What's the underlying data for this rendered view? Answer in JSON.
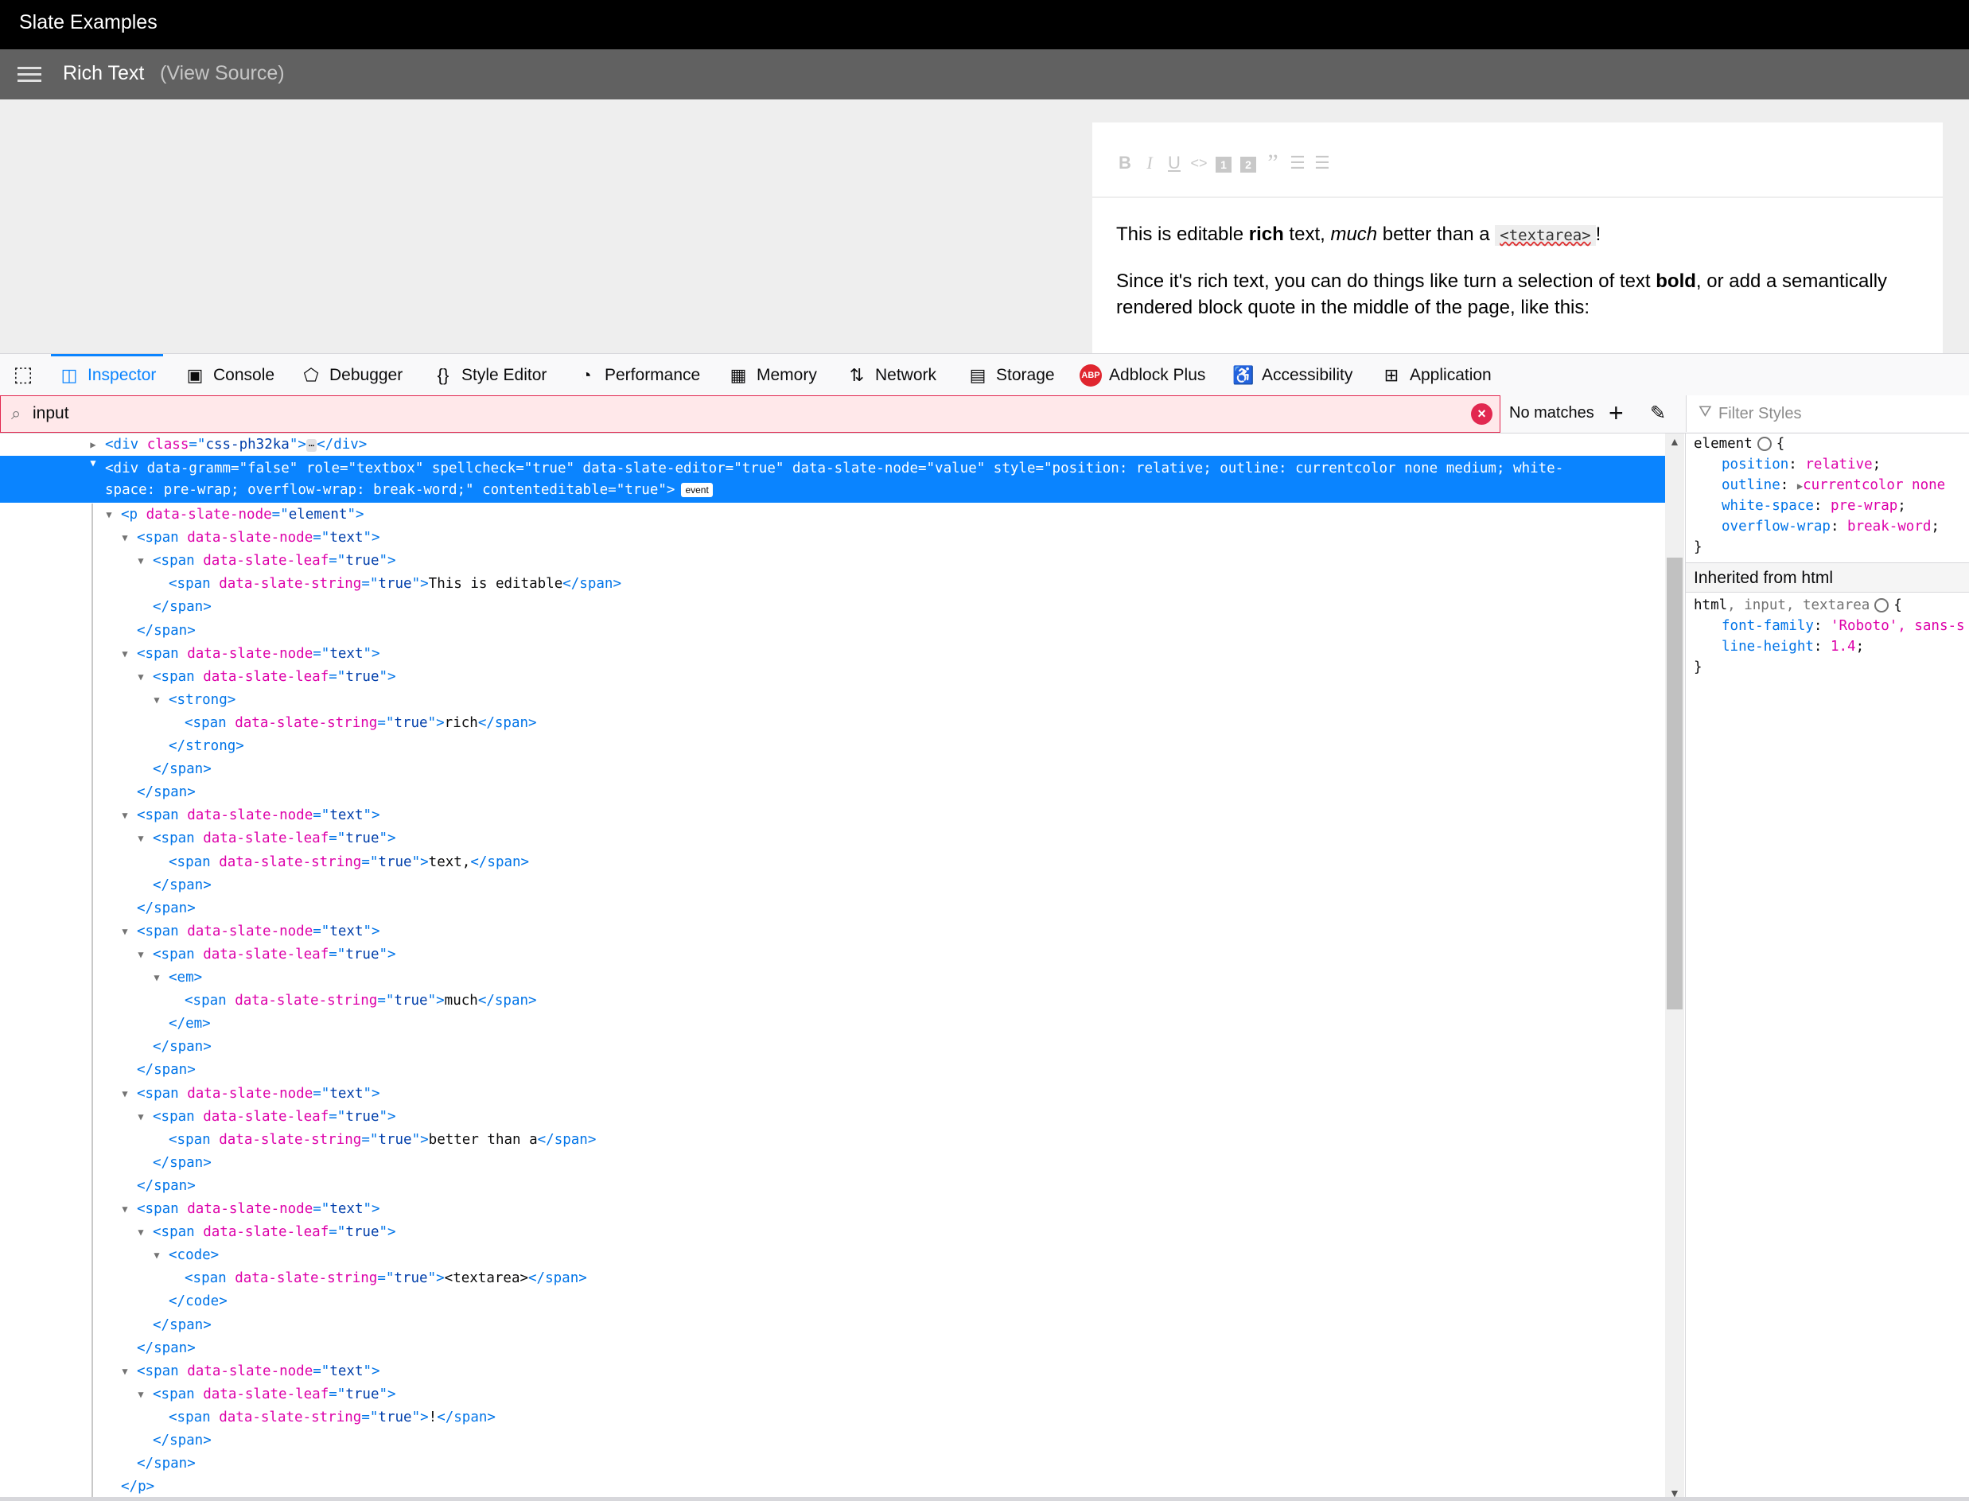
{
  "page": {
    "app_title": "Slate Examples",
    "example_title": "Rich Text",
    "view_source": "(View Source)"
  },
  "editor": {
    "toolbar": [
      {
        "name": "bold",
        "glyph": "B"
      },
      {
        "name": "italic",
        "glyph": "I"
      },
      {
        "name": "underline",
        "glyph": "U"
      },
      {
        "name": "code",
        "glyph": "<>"
      },
      {
        "name": "heading-one",
        "glyph": "1"
      },
      {
        "name": "heading-two",
        "glyph": "2"
      },
      {
        "name": "block-quote",
        "glyph": "”"
      },
      {
        "name": "numbered-list",
        "glyph": "☰"
      },
      {
        "name": "bulleted-list",
        "glyph": "☰"
      }
    ],
    "p1": {
      "a": "This is editable ",
      "b": "rich",
      "c": " text, ",
      "d": "much",
      "e": " better than a ",
      "f": "<textarea>",
      "g": "!"
    },
    "p2": {
      "a": "Since it's rich text, you can do things like turn a selection of text ",
      "b": "bold",
      "c": ", or add a semantically rendered block quote in the middle of the page, like this:"
    }
  },
  "devtools": {
    "tabs": [
      {
        "label": "Inspector",
        "icon": "inspector-icon",
        "selected": true
      },
      {
        "label": "Console",
        "icon": "console-icon"
      },
      {
        "label": "Debugger",
        "icon": "debugger-icon"
      },
      {
        "label": "Style Editor",
        "icon": "braces-icon"
      },
      {
        "label": "Performance",
        "icon": "gauge-icon"
      },
      {
        "label": "Memory",
        "icon": "chip-icon"
      },
      {
        "label": "Network",
        "icon": "arrows-icon"
      },
      {
        "label": "Storage",
        "icon": "storage-icon"
      },
      {
        "label": "Adblock Plus",
        "icon": "abp-icon"
      },
      {
        "label": "Accessibility",
        "icon": "accessibility-icon"
      },
      {
        "label": "Application",
        "icon": "grid-icon"
      }
    ],
    "abp_badge": "ABP",
    "search": {
      "value": "input",
      "status": "No matches"
    },
    "filter_styles_placeholder": "Filter Styles",
    "event_badge": "event",
    "ellipsis_badge": "⋯"
  },
  "markup_lines": [
    {
      "d": 0,
      "tw": "closed",
      "p": [
        [
          "t",
          "<div "
        ],
        [
          "a",
          "class"
        ],
        [
          "t",
          "=\""
        ],
        [
          "v",
          "css-ph32ka"
        ],
        [
          "t",
          "\">"
        ],
        [
          "badge",
          ""
        ],
        [
          "t",
          "</div>"
        ]
      ]
    },
    {
      "d": 1,
      "tw": "open",
      "p": [
        [
          "t",
          "<p "
        ],
        [
          "a",
          "data-slate-node"
        ],
        [
          "t",
          "=\""
        ],
        [
          "v",
          "element"
        ],
        [
          "t",
          "\">"
        ]
      ]
    },
    {
      "d": 2,
      "tw": "open",
      "p": [
        [
          "t",
          "<span "
        ],
        [
          "a",
          "data-slate-node"
        ],
        [
          "t",
          "=\""
        ],
        [
          "v",
          "text"
        ],
        [
          "t",
          "\">"
        ]
      ]
    },
    {
      "d": 3,
      "tw": "open",
      "p": [
        [
          "t",
          "<span "
        ],
        [
          "a",
          "data-slate-leaf"
        ],
        [
          "t",
          "=\""
        ],
        [
          "v",
          "true"
        ],
        [
          "t",
          "\">"
        ]
      ]
    },
    {
      "d": 4,
      "tw": "",
      "p": [
        [
          "t",
          "<span "
        ],
        [
          "a",
          "data-slate-string"
        ],
        [
          "t",
          "=\""
        ],
        [
          "v",
          "true"
        ],
        [
          "t",
          "\">"
        ],
        [
          "x",
          "This is editable"
        ],
        [
          "t",
          "</span>"
        ]
      ]
    },
    {
      "d": 3,
      "tw": "",
      "p": [
        [
          "t",
          "</span>"
        ]
      ]
    },
    {
      "d": 2,
      "tw": "",
      "p": [
        [
          "t",
          "</span>"
        ]
      ]
    },
    {
      "d": 2,
      "tw": "open",
      "p": [
        [
          "t",
          "<span "
        ],
        [
          "a",
          "data-slate-node"
        ],
        [
          "t",
          "=\""
        ],
        [
          "v",
          "text"
        ],
        [
          "t",
          "\">"
        ]
      ]
    },
    {
      "d": 3,
      "tw": "open",
      "p": [
        [
          "t",
          "<span "
        ],
        [
          "a",
          "data-slate-leaf"
        ],
        [
          "t",
          "=\""
        ],
        [
          "v",
          "true"
        ],
        [
          "t",
          "\">"
        ]
      ]
    },
    {
      "d": 4,
      "tw": "open",
      "p": [
        [
          "t",
          "<strong>"
        ]
      ]
    },
    {
      "d": 5,
      "tw": "",
      "p": [
        [
          "t",
          "<span "
        ],
        [
          "a",
          "data-slate-string"
        ],
        [
          "t",
          "=\""
        ],
        [
          "v",
          "true"
        ],
        [
          "t",
          "\">"
        ],
        [
          "x",
          "rich"
        ],
        [
          "t",
          "</span>"
        ]
      ]
    },
    {
      "d": 4,
      "tw": "",
      "p": [
        [
          "t",
          "</strong>"
        ]
      ]
    },
    {
      "d": 3,
      "tw": "",
      "p": [
        [
          "t",
          "</span>"
        ]
      ]
    },
    {
      "d": 2,
      "tw": "",
      "p": [
        [
          "t",
          "</span>"
        ]
      ]
    },
    {
      "d": 2,
      "tw": "open",
      "p": [
        [
          "t",
          "<span "
        ],
        [
          "a",
          "data-slate-node"
        ],
        [
          "t",
          "=\""
        ],
        [
          "v",
          "text"
        ],
        [
          "t",
          "\">"
        ]
      ]
    },
    {
      "d": 3,
      "tw": "open",
      "p": [
        [
          "t",
          "<span "
        ],
        [
          "a",
          "data-slate-leaf"
        ],
        [
          "t",
          "=\""
        ],
        [
          "v",
          "true"
        ],
        [
          "t",
          "\">"
        ]
      ]
    },
    {
      "d": 4,
      "tw": "",
      "p": [
        [
          "t",
          "<span "
        ],
        [
          "a",
          "data-slate-string"
        ],
        [
          "t",
          "=\""
        ],
        [
          "v",
          "true"
        ],
        [
          "t",
          "\">"
        ],
        [
          "x",
          "text,"
        ],
        [
          "t",
          "</span>"
        ]
      ]
    },
    {
      "d": 3,
      "tw": "",
      "p": [
        [
          "t",
          "</span>"
        ]
      ]
    },
    {
      "d": 2,
      "tw": "",
      "p": [
        [
          "t",
          "</span>"
        ]
      ]
    },
    {
      "d": 2,
      "tw": "open",
      "p": [
        [
          "t",
          "<span "
        ],
        [
          "a",
          "data-slate-node"
        ],
        [
          "t",
          "=\""
        ],
        [
          "v",
          "text"
        ],
        [
          "t",
          "\">"
        ]
      ]
    },
    {
      "d": 3,
      "tw": "open",
      "p": [
        [
          "t",
          "<span "
        ],
        [
          "a",
          "data-slate-leaf"
        ],
        [
          "t",
          "=\""
        ],
        [
          "v",
          "true"
        ],
        [
          "t",
          "\">"
        ]
      ]
    },
    {
      "d": 4,
      "tw": "open",
      "p": [
        [
          "t",
          "<em>"
        ]
      ]
    },
    {
      "d": 5,
      "tw": "",
      "p": [
        [
          "t",
          "<span "
        ],
        [
          "a",
          "data-slate-string"
        ],
        [
          "t",
          "=\""
        ],
        [
          "v",
          "true"
        ],
        [
          "t",
          "\">"
        ],
        [
          "x",
          "much"
        ],
        [
          "t",
          "</span>"
        ]
      ]
    },
    {
      "d": 4,
      "tw": "",
      "p": [
        [
          "t",
          "</em>"
        ]
      ]
    },
    {
      "d": 3,
      "tw": "",
      "p": [
        [
          "t",
          "</span>"
        ]
      ]
    },
    {
      "d": 2,
      "tw": "",
      "p": [
        [
          "t",
          "</span>"
        ]
      ]
    },
    {
      "d": 2,
      "tw": "open",
      "p": [
        [
          "t",
          "<span "
        ],
        [
          "a",
          "data-slate-node"
        ],
        [
          "t",
          "=\""
        ],
        [
          "v",
          "text"
        ],
        [
          "t",
          "\">"
        ]
      ]
    },
    {
      "d": 3,
      "tw": "open",
      "p": [
        [
          "t",
          "<span "
        ],
        [
          "a",
          "data-slate-leaf"
        ],
        [
          "t",
          "=\""
        ],
        [
          "v",
          "true"
        ],
        [
          "t",
          "\">"
        ]
      ]
    },
    {
      "d": 4,
      "tw": "",
      "p": [
        [
          "t",
          "<span "
        ],
        [
          "a",
          "data-slate-string"
        ],
        [
          "t",
          "=\""
        ],
        [
          "v",
          "true"
        ],
        [
          "t",
          "\">"
        ],
        [
          "x",
          "better than a"
        ],
        [
          "t",
          "</span>"
        ]
      ]
    },
    {
      "d": 3,
      "tw": "",
      "p": [
        [
          "t",
          "</span>"
        ]
      ]
    },
    {
      "d": 2,
      "tw": "",
      "p": [
        [
          "t",
          "</span>"
        ]
      ]
    },
    {
      "d": 2,
      "tw": "open",
      "p": [
        [
          "t",
          "<span "
        ],
        [
          "a",
          "data-slate-node"
        ],
        [
          "t",
          "=\""
        ],
        [
          "v",
          "text"
        ],
        [
          "t",
          "\">"
        ]
      ]
    },
    {
      "d": 3,
      "tw": "open",
      "p": [
        [
          "t",
          "<span "
        ],
        [
          "a",
          "data-slate-leaf"
        ],
        [
          "t",
          "=\""
        ],
        [
          "v",
          "true"
        ],
        [
          "t",
          "\">"
        ]
      ]
    },
    {
      "d": 4,
      "tw": "open",
      "p": [
        [
          "t",
          "<code>"
        ]
      ]
    },
    {
      "d": 5,
      "tw": "",
      "p": [
        [
          "t",
          "<span "
        ],
        [
          "a",
          "data-slate-string"
        ],
        [
          "t",
          "=\""
        ],
        [
          "v",
          "true"
        ],
        [
          "t",
          "\">"
        ],
        [
          "x",
          "<textarea>"
        ],
        [
          "t",
          "</span>"
        ]
      ]
    },
    {
      "d": 4,
      "tw": "",
      "p": [
        [
          "t",
          "</code>"
        ]
      ]
    },
    {
      "d": 3,
      "tw": "",
      "p": [
        [
          "t",
          "</span>"
        ]
      ]
    },
    {
      "d": 2,
      "tw": "",
      "p": [
        [
          "t",
          "</span>"
        ]
      ]
    },
    {
      "d": 2,
      "tw": "open",
      "p": [
        [
          "t",
          "<span "
        ],
        [
          "a",
          "data-slate-node"
        ],
        [
          "t",
          "=\""
        ],
        [
          "v",
          "text"
        ],
        [
          "t",
          "\">"
        ]
      ]
    },
    {
      "d": 3,
      "tw": "open",
      "p": [
        [
          "t",
          "<span "
        ],
        [
          "a",
          "data-slate-leaf"
        ],
        [
          "t",
          "=\""
        ],
        [
          "v",
          "true"
        ],
        [
          "t",
          "\">"
        ]
      ]
    },
    {
      "d": 4,
      "tw": "",
      "p": [
        [
          "t",
          "<span "
        ],
        [
          "a",
          "data-slate-string"
        ],
        [
          "t",
          "=\""
        ],
        [
          "v",
          "true"
        ],
        [
          "t",
          "\">"
        ],
        [
          "x",
          "!"
        ],
        [
          "t",
          "</span>"
        ]
      ]
    },
    {
      "d": 3,
      "tw": "",
      "p": [
        [
          "t",
          "</span>"
        ]
      ]
    },
    {
      "d": 2,
      "tw": "",
      "p": [
        [
          "t",
          "</span>"
        ]
      ]
    },
    {
      "d": 1,
      "tw": "",
      "p": [
        [
          "t",
          "</p>"
        ]
      ]
    }
  ],
  "selected_node": {
    "line1": "<div data-gramm=\"false\" role=\"textbox\" spellcheck=\"true\" data-slate-editor=\"true\" data-slate-node=\"value\" style=\"position: relative; outline: currentcolor none medium; white-",
    "line2": "space: pre-wrap; overflow-wrap: break-word;\" contenteditable=\"true\">"
  },
  "rules": {
    "element_selector": "element",
    "element_props": [
      {
        "prop": "position",
        "value": "relative"
      },
      {
        "prop": "outline",
        "value": "currentcolor none"
      },
      {
        "prop": "white-space",
        "value": "pre-wrap"
      },
      {
        "prop": "overflow-wrap",
        "value": "break-word"
      }
    ],
    "inherited_header": "Inherited from html",
    "inherited_selector_a": "html",
    "inherited_selector_b": ", input, textarea",
    "inherited_props": [
      {
        "prop": "font-family",
        "value": "'Roboto', sans-s"
      },
      {
        "prop": "line-height",
        "value": "1.4"
      }
    ]
  }
}
